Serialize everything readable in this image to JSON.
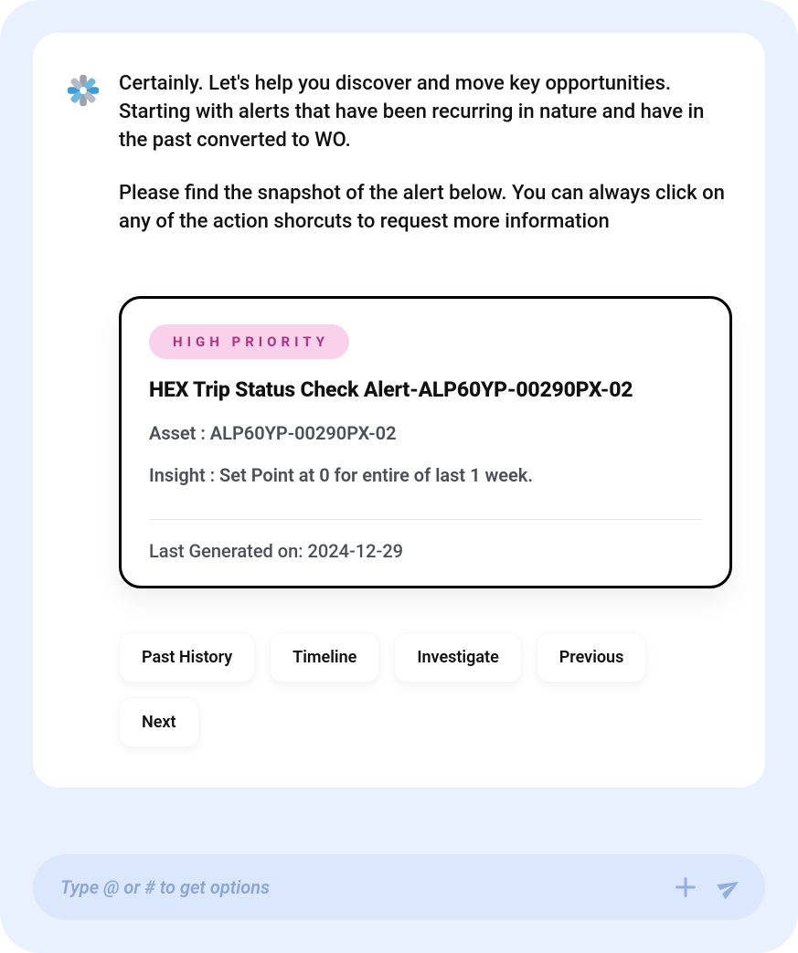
{
  "message": {
    "paragraph1": "Certainly. Let's help you discover and move key opportunities. Starting with alerts that have been recurring in nature and have in the past converted to WO.",
    "paragraph2": "Please find the snapshot of the alert below. You can always click on any of the action shorcuts to request more information"
  },
  "alert": {
    "priority_badge": "HIGH PRIORITY",
    "title": "HEX Trip Status Check Alert-ALP60YP-00290PX-02",
    "asset_line": "Asset : ALP60YP-00290PX-02",
    "insight_line": "Insight : Set Point at 0 for entire of last 1 week.",
    "generated_line": "Last Generated on: 2024-12-29"
  },
  "actions": {
    "past_history": "Past History",
    "timeline": "Timeline",
    "investigate": "Investigate",
    "previous": "Previous",
    "next": "Next"
  },
  "input": {
    "placeholder": "Type @ or # to get options"
  }
}
